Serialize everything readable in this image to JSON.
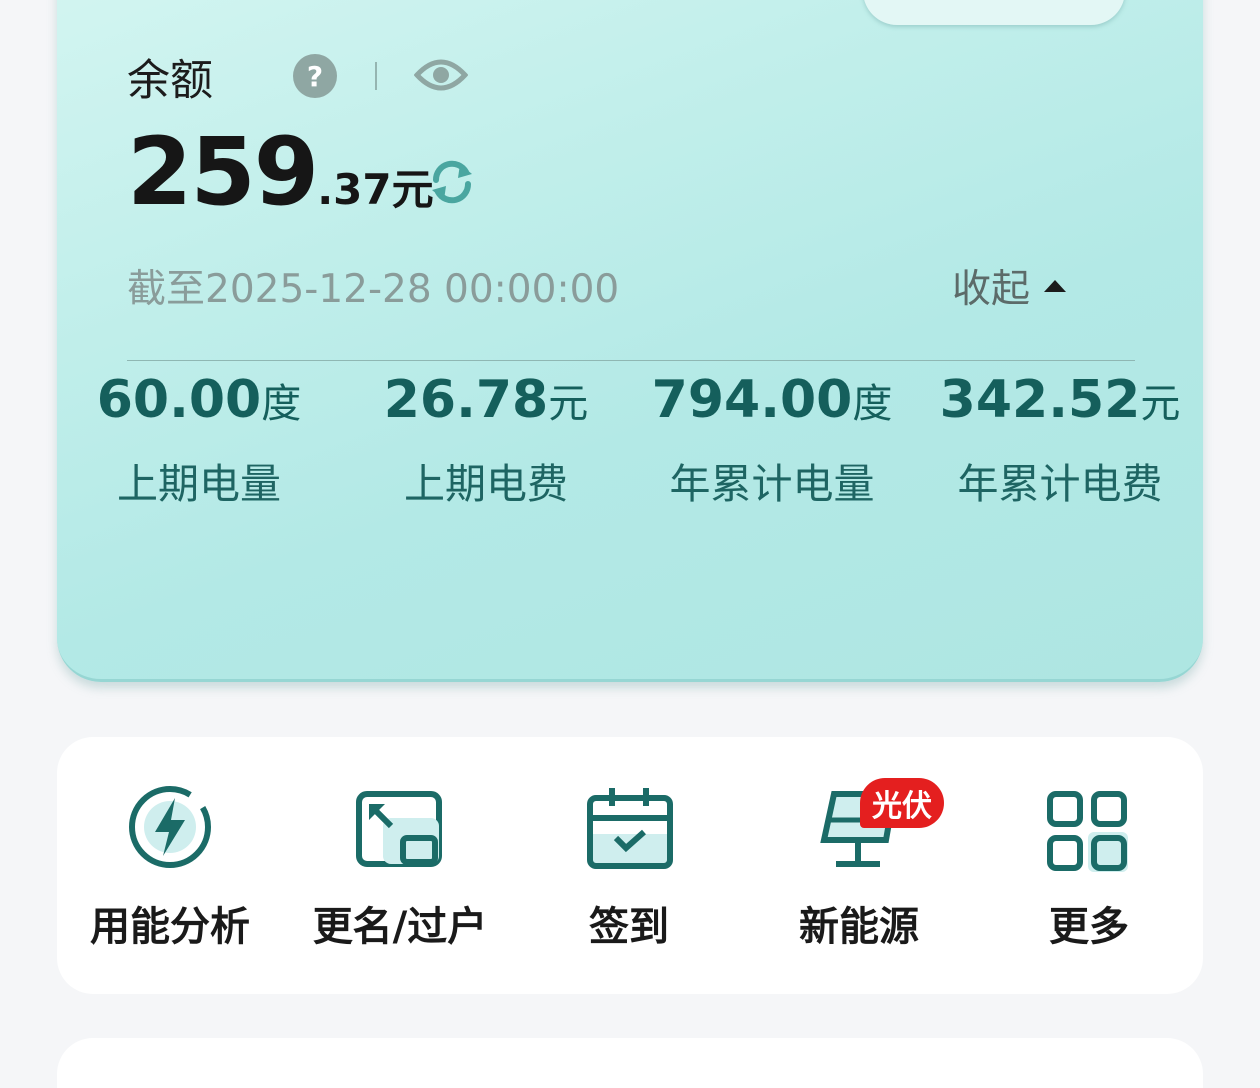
{
  "balance": {
    "label": "余额",
    "help_icon": "?",
    "amount_int": "259",
    "amount_dec": ".37",
    "amount_unit": "元",
    "as_of": "截至2025-12-28 00:00:00",
    "collapse_label": "收起"
  },
  "stats": [
    {
      "value": "60.00",
      "unit": "度",
      "label": "上期电量"
    },
    {
      "value": "26.78",
      "unit": "元",
      "label": "上期电费"
    },
    {
      "value": "794.00",
      "unit": "度",
      "label": "年累计电量"
    },
    {
      "value": "342.52",
      "unit": "元",
      "label": "年累计电费"
    }
  ],
  "menu": [
    {
      "label": "用能分析",
      "icon": "energy-analysis-icon"
    },
    {
      "label": "更名/过户",
      "icon": "rename-transfer-icon"
    },
    {
      "label": "签到",
      "icon": "calendar-checkin-icon"
    },
    {
      "label": "新能源",
      "icon": "solar-panel-icon",
      "badge": "光伏"
    },
    {
      "label": "更多",
      "icon": "grid-more-icon"
    }
  ],
  "colors": {
    "accent": "#155f5c",
    "icon_stroke": "#1b6b67",
    "badge": "#e41f1f"
  }
}
